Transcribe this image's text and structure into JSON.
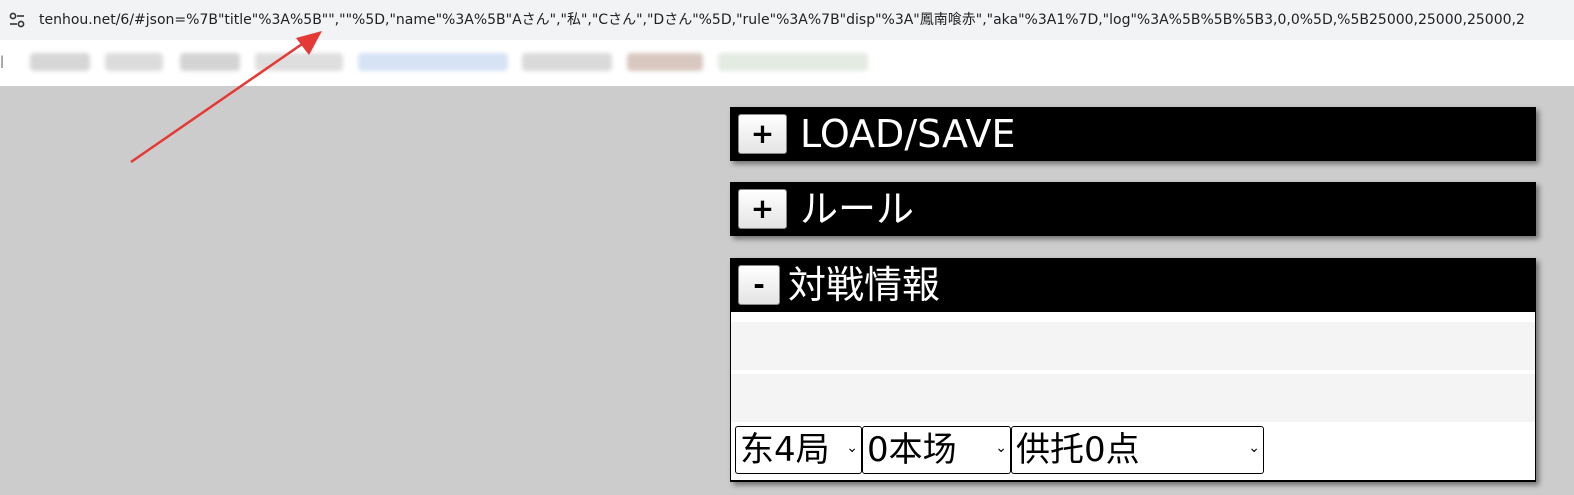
{
  "browser": {
    "url": "tenhou.net/6/#json=%7B\"title\"%3A%5B\"\",\"\"%5D,\"name\"%3A%5B\"Aさん\",\"私\",\"Cさん\",\"Dさん\"%5D,\"rule\"%3A%7B\"disp\"%3A\"鳳南喰赤\",\"aka\"%3A1%7D,\"log\"%3A%5B%5B%5B3,0,0%5D,%5B25000,25000,25000,2",
    "site_icon": "tune-icon"
  },
  "panels": {
    "load_save": {
      "toggle": "+",
      "title": "LOAD/SAVE"
    },
    "rule": {
      "toggle": "+",
      "title": "ルール"
    },
    "match_info": {
      "toggle": "-",
      "title": "対戦情報",
      "round_select": "东4局",
      "honba_select": "0本场",
      "kyotaku_select": "供托0点"
    }
  },
  "colors": {
    "page_bg": "#cccccc",
    "panel_header": "#000000",
    "annotation_arrow": "#e53935"
  }
}
